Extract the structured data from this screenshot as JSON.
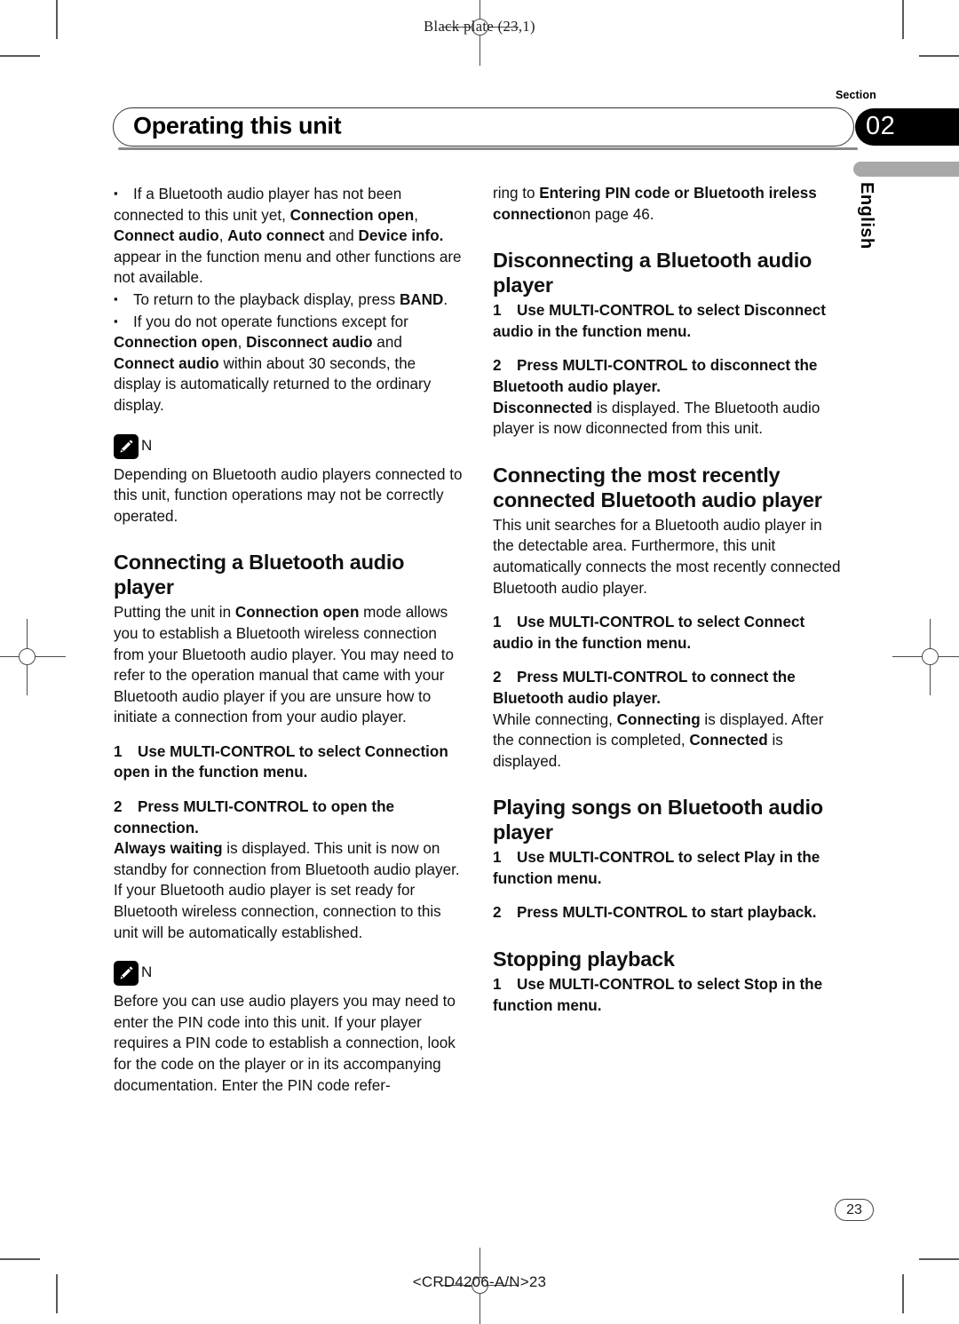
{
  "page": {
    "plate_note": "Black plate (23,1)",
    "footer_code": "<CRD4206-A/N>23",
    "page_number": "23"
  },
  "header": {
    "section_label": "Section",
    "section_number": "02",
    "title": "Operating this unit",
    "language_tab": "English"
  },
  "left_column": {
    "bullets": [
      {
        "runs": [
          {
            "t": "If a Bluetooth audio player has not been connected to this unit yet, ",
            "b": false
          },
          {
            "t": "Connection open",
            "b": true
          },
          {
            "t": ", ",
            "b": false
          },
          {
            "t": "Connect audio",
            "b": true
          },
          {
            "t": ", ",
            "b": false
          },
          {
            "t": "Auto connect",
            "b": true
          },
          {
            "t": " and ",
            "b": false
          },
          {
            "t": "Device info.",
            "b": true
          },
          {
            "t": " appear in the function menu and other functions are not available.",
            "b": false
          }
        ]
      },
      {
        "runs": [
          {
            "t": "To return to the playback display, press ",
            "b": false
          },
          {
            "t": "BAND",
            "b": true
          },
          {
            "t": ".",
            "b": false
          }
        ]
      },
      {
        "runs": [
          {
            "t": "If you do not operate functions except for ",
            "b": false
          },
          {
            "t": "Connection open",
            "b": true
          },
          {
            "t": ",  ",
            "b": false
          },
          {
            "t": "Disconnect audio",
            "b": true
          },
          {
            "t": " and ",
            "b": false
          },
          {
            "t": "Connect audio",
            "b": true
          },
          {
            "t": " within about 30 seconds, the display is automatically returned to the ordinary display.",
            "b": false
          }
        ]
      }
    ],
    "note1": {
      "icon": "note-pencil-icon",
      "label": "N",
      "body": "Depending on Bluetooth audio players connected to this unit, function operations may not be correctly operated."
    },
    "heading1": "Connecting a Bluetooth audio player",
    "intro1": [
      {
        "t": "Putting the unit in ",
        "b": false
      },
      {
        "t": "Connection open",
        "b": true
      },
      {
        "t": " mode allows you to establish a Bluetooth wireless connection from your Bluetooth audio player. You may need to refer to the operation manual that came with your Bluetooth audio player if you are unsure how to initiate a connection from your audio player.",
        "b": false
      }
    ],
    "step1": {
      "num": "1",
      "text": "Use MULTI-CONTROL to select Connection open in the function menu."
    },
    "step2": {
      "num": "2",
      "text": "Press MULTI-CONTROL to open the connection."
    },
    "step2_body": [
      {
        "t": "Always waiting",
        "b": true
      },
      {
        "t": " is displayed. This unit is now on standby for connection from Bluetooth audio player.",
        "b": false
      }
    ],
    "step2_body2": "If your Bluetooth audio player is set ready for Bluetooth wireless connection, connection to this unit will be automatically established.",
    "note2": {
      "icon": "note-pencil-icon",
      "label": "N",
      "body": "Before you can use audio players you may need to enter the PIN code into this unit. If your player requires a PIN code to establish a connection, look for the code on the player or in its accompanying documentation. Enter the PIN code refer-"
    }
  },
  "right_column": {
    "continuation": [
      {
        "t": "ring to ",
        "b": false
      },
      {
        "t": "Entering PIN code or Bluetooth ireless connection",
        "b": true
      },
      {
        "t": "on page 46.",
        "b": false
      }
    ],
    "heading1": "Disconnecting a Bluetooth audio player",
    "d_step1": {
      "num": "1",
      "text": "Use MULTI-CONTROL to select Disconnect audio in the function menu."
    },
    "d_step2": {
      "num": "2",
      "text": "Press MULTI-CONTROL to disconnect the Bluetooth audio player."
    },
    "d_step2_body": [
      {
        "t": "Disconnected",
        "b": true
      },
      {
        "t": " is displayed. The Bluetooth audio player is now diconnected from this unit.",
        "b": false
      }
    ],
    "heading2": "Connecting the most recently connected Bluetooth audio player",
    "intro2": "This unit searches for a Bluetooth audio player in the detectable area. Furthermore, this unit automatically connects the most recently connected Bluetooth audio player.",
    "c_step1": {
      "num": "1",
      "text": "Use MULTI-CONTROL to select Connect audio in the function menu."
    },
    "c_step2": {
      "num": "2",
      "text": "Press MULTI-CONTROL to connect the Bluetooth audio player."
    },
    "c_step2_body": [
      {
        "t": "While connecting, ",
        "b": false
      },
      {
        "t": "Connecting",
        "b": true
      },
      {
        "t": " is displayed. After the connection is completed, ",
        "b": false
      },
      {
        "t": "Connected",
        "b": true
      },
      {
        "t": " is displayed.",
        "b": false
      }
    ],
    "heading3": "Playing songs on Bluetooth audio player",
    "p_step1": {
      "num": "1",
      "text": "Use MULTI-CONTROL to select Play in the function menu."
    },
    "p_step2": {
      "num": "2",
      "text": "Press MULTI-CONTROL to start playback."
    },
    "heading4": "Stopping playback",
    "s_step1": {
      "num": "1",
      "text": "Use MULTI-CONTROL to select Stop in the function menu."
    }
  }
}
